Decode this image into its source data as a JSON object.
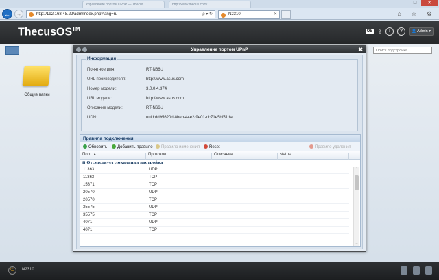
{
  "browser": {
    "bg_tabs": [
      "Управление портом UPnP — Thecus",
      "http://www.thecus.com/…"
    ],
    "url": "http://192.168.48.22/adm/index.php?lang=ru",
    "addr_icons": "ρ ▾ ↻",
    "tab_title": "N2310",
    "right_icons": "⌂ ☆ ⚙",
    "back_icon": "back-arrow",
    "fwd_icon": "forward-arrow"
  },
  "header": {
    "logo": "ThecusOS",
    "logo_tm": "TM",
    "os_badge": "OS",
    "admin_label": "Admin"
  },
  "desktop": {
    "folder_label": "Общие папки",
    "search_placeholder": "Поиск подстройка"
  },
  "dialog": {
    "title": "Управление портом UPnP",
    "info_title": "Информация",
    "info": [
      {
        "label": "Понятное имя:",
        "value": "RT-N66U"
      },
      {
        "label": "URL производителя:",
        "value": "http://www.asus.com"
      },
      {
        "label": "Номер модели:",
        "value": "3.0.0.4.374"
      },
      {
        "label": "URL модели:",
        "value": "http://www.asus.com"
      },
      {
        "label": "Описание модели:",
        "value": "RT-N66U"
      },
      {
        "label": "UDN:",
        "value": "uuid:dd95620d-8beb-44e2-9e01-dc71e5bf51da"
      }
    ],
    "rules_title": "Правила подключения",
    "toolbar": {
      "refresh": "Обновить",
      "add": "Добавить правило",
      "modify": "Правило изменения",
      "reset": "Reset",
      "delete": "Правило удаления"
    },
    "columns": [
      "Порт ▲",
      "Протокол",
      "Описание",
      "status"
    ],
    "group_label": "⊟ Отсутствует локальная настройка",
    "rows": [
      {
        "port": "11363",
        "protocol": "UDP"
      },
      {
        "port": "11363",
        "protocol": "TCP"
      },
      {
        "port": "15371",
        "protocol": "TCP"
      },
      {
        "port": "20570",
        "protocol": "UDP"
      },
      {
        "port": "20570",
        "protocol": "TCP"
      },
      {
        "port": "35575",
        "protocol": "UDP"
      },
      {
        "port": "35575",
        "protocol": "TCP"
      },
      {
        "port": "4071",
        "protocol": "UDP"
      },
      {
        "port": "4071",
        "protocol": "TCP"
      }
    ]
  },
  "taskbar": {
    "label": "N2310"
  },
  "colors": {
    "accent": "#1f6fc4",
    "header_dark": "#26282a",
    "folder": "#e2a90e"
  }
}
